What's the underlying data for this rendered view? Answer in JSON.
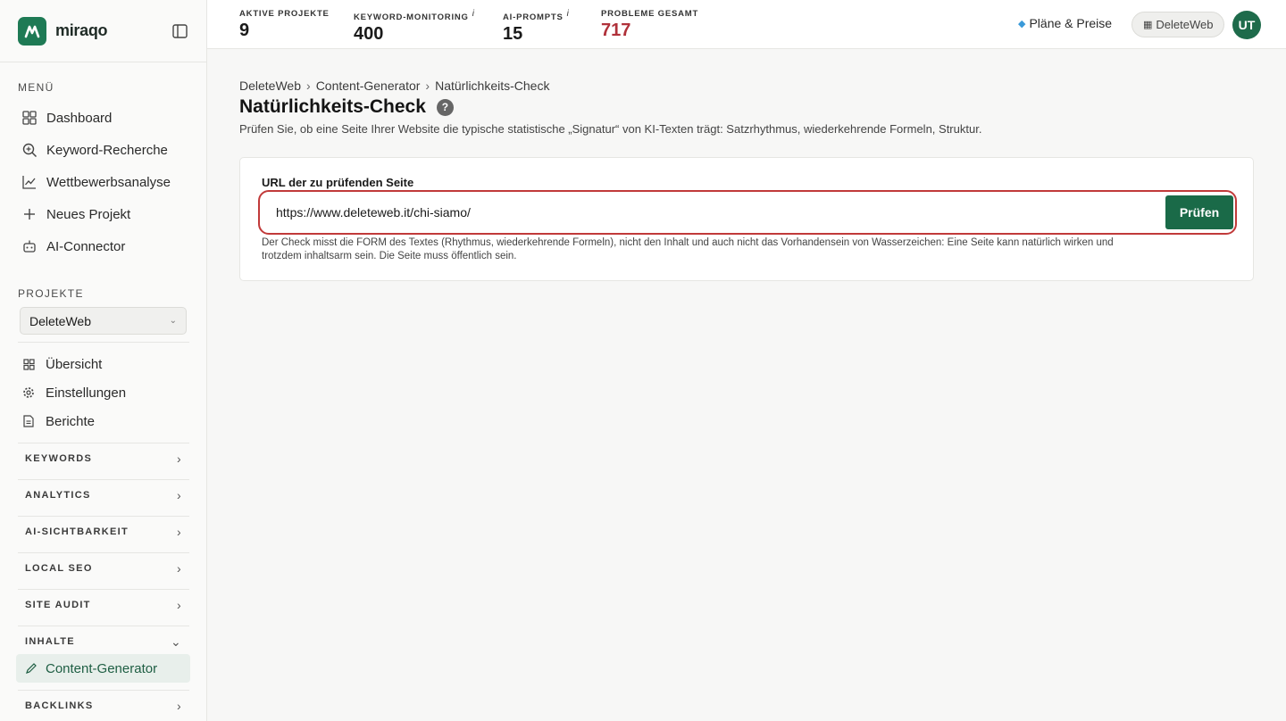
{
  "brand": {
    "name": "miraqo"
  },
  "sidebar": {
    "menu_label": "MENÜ",
    "menu_items": [
      {
        "label": "Dashboard",
        "icon": "grid-icon"
      },
      {
        "label": "Keyword-Recherche",
        "icon": "search-icon"
      },
      {
        "label": "Wettbewerbsanalyse",
        "icon": "chart-line-icon"
      },
      {
        "label": "Neues Projekt",
        "icon": "plus-icon"
      },
      {
        "label": "AI-Connector",
        "icon": "robot-icon"
      }
    ],
    "projects_label": "PROJEKTE",
    "project_selected": "DeleteWeb",
    "project_items": [
      {
        "label": "Übersicht",
        "icon": "grid-small-icon"
      },
      {
        "label": "Einstellungen",
        "icon": "gear-icon"
      },
      {
        "label": "Berichte",
        "icon": "document-icon"
      }
    ],
    "groups": [
      {
        "label": "KEYWORDS"
      },
      {
        "label": "ANALYTICS"
      },
      {
        "label": "AI-SICHTBARKEIT"
      },
      {
        "label": "LOCAL SEO"
      },
      {
        "label": "SITE AUDIT"
      },
      {
        "label": "INHALTE"
      },
      {
        "label": "BACKLINKS"
      }
    ],
    "active_item": "Content-Generator"
  },
  "topbar": {
    "stats": [
      {
        "label": "AKTIVE PROJEKTE",
        "value": "9",
        "info": ""
      },
      {
        "label": "KEYWORD-MONITORING",
        "value": "400",
        "info": "i"
      },
      {
        "label": "AI-PROMPTS",
        "value": "15",
        "info": "i"
      },
      {
        "label": "PROBLEME GESAMT",
        "value": "717",
        "info": ""
      }
    ],
    "plans_label": "Pläne & Preise",
    "workspace_label": "DeleteWeb",
    "avatar_initials": "UT",
    "colors": {
      "brand": "#1e7a55",
      "alert": "#b0313a"
    }
  },
  "content": {
    "breadcrumb": [
      "DeleteWeb",
      "Content-Generator",
      "Natürlichkeits-Check"
    ],
    "breadcrumb_sep": "›",
    "title": "Natürlichkeits-Check",
    "help_glyph": "?",
    "subtitle": "Prüfen Sie, ob eine Seite Ihrer Website die typische statistische „Signatur“ von KI-Texten trägt: Satzrhythmus, wiederkehrende Formeln, Struktur.",
    "field_label": "URL der zu prüfenden Seite",
    "url_value": "https://www.deleteweb.it/chi-siamo/",
    "button_label": "Prüfen",
    "hint_line1": "Der Check misst die FORM des Textes (Rhythmus, wiederkehrende Formeln), nicht den Inhalt und auch nicht das Vorhandensein von Wasserzeichen: Eine Seite kann natürlich wirken und",
    "hint_line2": "trotzdem inhaltsarm sein. Die Seite muss öffentlich sein."
  }
}
